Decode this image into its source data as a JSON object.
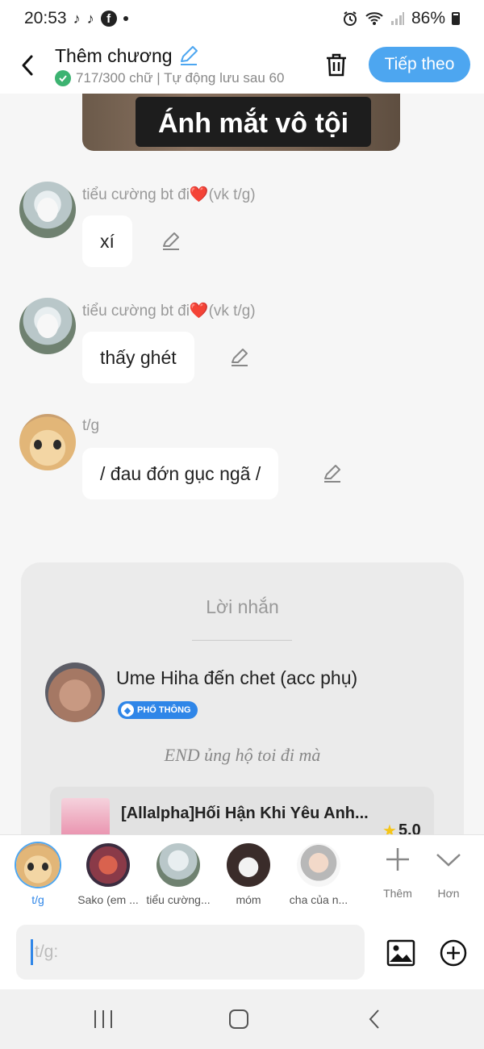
{
  "status": {
    "time": "20:53",
    "battery": "86%",
    "icons": [
      "tiktok-icon",
      "tiktok-icon",
      "facebook-icon",
      "alarm-icon",
      "wifi-icon",
      "signal-icon",
      "battery-icon"
    ]
  },
  "header": {
    "title": "Thêm chương",
    "subtitle": "717/300 chữ | Tự động lưu sau 60",
    "next_label": "Tiếp theo"
  },
  "top_image": {
    "caption": "Ánh mắt vô tội"
  },
  "messages": [
    {
      "name": "tiểu cường bt đi❤️(vk t/g)",
      "text": "xí",
      "avatar": "anime-girl-avatar"
    },
    {
      "name": "tiểu cường bt đi❤️(vk t/g)",
      "text": "thấy ghét",
      "avatar": "anime-girl-avatar"
    },
    {
      "name": "t/g",
      "text": "/ đau đớn gục ngã /",
      "avatar": "cat-avatar"
    }
  ],
  "note": {
    "title": "Lời nhắn",
    "user": "Ume Hiha đến chet (acc phụ)",
    "badge": "PHỔ THÔNG",
    "text": "END ủng hộ toi đi mà",
    "book": {
      "title": "[Allalpha]Hối Hận Khi Yêu Anh...",
      "rating": "5.0"
    }
  },
  "characters": [
    {
      "name": "t/g"
    },
    {
      "name": "Sako (em ..."
    },
    {
      "name": "tiểu cường..."
    },
    {
      "name": "móm"
    },
    {
      "name": "cha của n..."
    }
  ],
  "tools": {
    "add_label": "Thêm",
    "more_label": "Hơn"
  },
  "input": {
    "placeholder": "t/g:"
  },
  "colors": {
    "accent": "#4da6f0",
    "background": "#f6f6f6",
    "bubble": "#ffffff"
  }
}
